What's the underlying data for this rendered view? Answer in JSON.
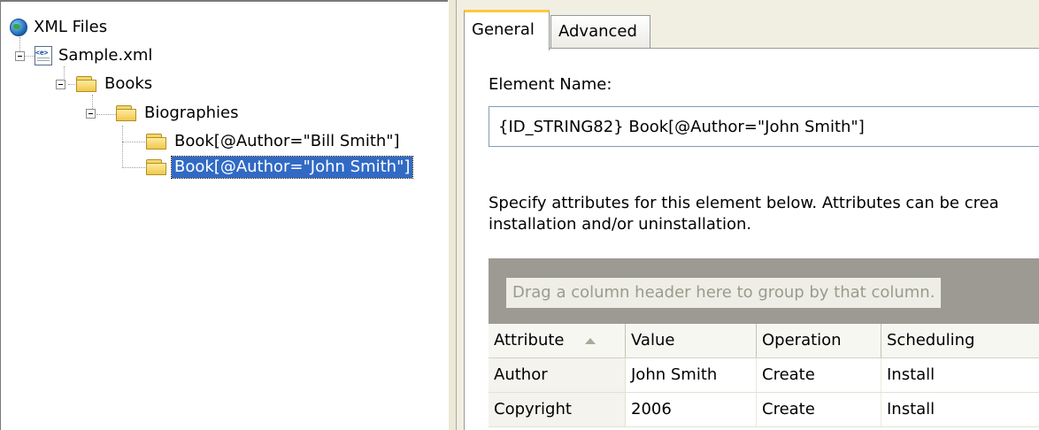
{
  "tree": {
    "root": {
      "label": "XML Files",
      "icon": "globe-icon"
    },
    "file": {
      "label": "Sample.xml",
      "icon": "xml-file-icon"
    },
    "books": {
      "label": "Books",
      "icon": "folder-icon"
    },
    "biographies": {
      "label": "Biographies",
      "icon": "folder-icon"
    },
    "book1": {
      "label": "Book[@Author=\"Bill Smith\"]",
      "icon": "folder-icon"
    },
    "book2": {
      "label": "Book[@Author=\"John Smith\"]",
      "icon": "folder-icon",
      "selected": true
    }
  },
  "tabs": [
    {
      "label": "General",
      "active": true
    },
    {
      "label": "Advanced",
      "active": false
    }
  ],
  "general": {
    "element_name_label": "Element Name:",
    "element_name_value": "{ID_STRING82} Book[@Author=\"John Smith\"]",
    "description_line1": "Specify attributes for this element below. Attributes can be crea",
    "description_line2": "installation and/or uninstallation."
  },
  "grid": {
    "group_hint": "Drag a column header here to group by that column.",
    "columns": [
      "Attribute",
      "Value",
      "Operation",
      "Scheduling"
    ],
    "sorted_column": "Attribute",
    "rows": [
      [
        "Author",
        "John Smith",
        "Create",
        "Install"
      ],
      [
        "Copyright",
        "2006",
        "Create",
        "Install"
      ]
    ]
  },
  "colors": {
    "selection": "#316ac5",
    "tab_accent": "#ffc83c",
    "group_area": "#9c9a93"
  }
}
